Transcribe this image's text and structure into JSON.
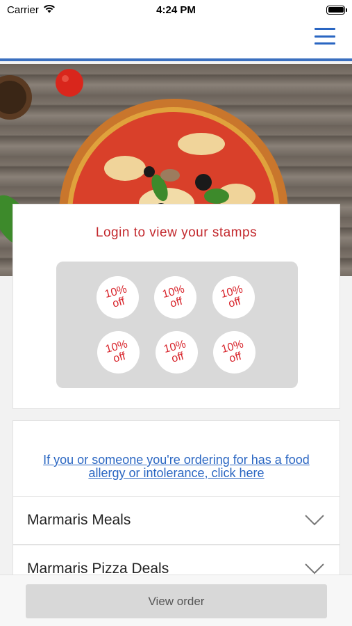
{
  "status_bar": {
    "carrier": "Carrier",
    "time": "4:24 PM"
  },
  "nav": {
    "menu_icon": "hamburger-menu-icon",
    "accent_color": "#2a66c2"
  },
  "stamps": {
    "title": "Login to view your stamps",
    "title_color": "#c3292e",
    "items": [
      {
        "line1": "10%",
        "line2": "off"
      },
      {
        "line1": "10%",
        "line2": "off"
      },
      {
        "line1": "10%",
        "line2": "off"
      },
      {
        "line1": "10%",
        "line2": "off"
      },
      {
        "line1": "10%",
        "line2": "off"
      },
      {
        "line1": "10%",
        "line2": "off"
      }
    ]
  },
  "allergy": {
    "link_text": "If you or someone you're ordering for has a food allergy or intolerance, click here"
  },
  "menu_sections": [
    {
      "label": "Marmaris Meals",
      "icon": "chevron-down-icon"
    },
    {
      "label": "Marmaris Pizza Deals",
      "icon": "chevron-down-icon"
    }
  ],
  "footer": {
    "view_order_label": "View order"
  }
}
